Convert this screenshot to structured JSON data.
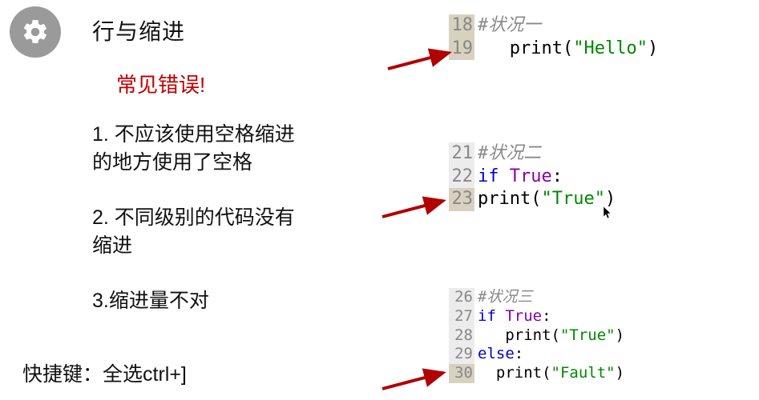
{
  "header": {
    "title": "行与缩进",
    "subtitle": "常见错误!"
  },
  "bullets": {
    "b1": "1. 不应该使用空格缩进\n    的地方使用了空格",
    "b2": "2. 不同级别的代码没有\n    缩进",
    "b3": "3.缩进量不对"
  },
  "shortcut": "快捷键：全选ctrl+]",
  "code1": {
    "l18_num": "18",
    "l18_comment": "#状况一",
    "l19_num": "19",
    "l19_indent": "   ",
    "l19_fn": "print",
    "l19_lp": "(",
    "l19_str": "\"Hello\"",
    "l19_rp": ")"
  },
  "code2": {
    "l21_num": "21",
    "l21_comment": "#状况二",
    "l22_num": "22",
    "l22_kw": "if",
    "l22_sp": " ",
    "l22_bool": "True",
    "l22_colon": ":",
    "l23_num": "23",
    "l23_fn": "print",
    "l23_lp": "(",
    "l23_str": "\"True\"",
    "l23_rp": ")"
  },
  "code3": {
    "l26_num": "26",
    "l26_comment": "#状况三",
    "l27_num": "27",
    "l27_kw": "if",
    "l27_sp": " ",
    "l27_bool": "True",
    "l27_colon": ":",
    "l28_num": "28",
    "l28_indent": "   ",
    "l28_fn": "print",
    "l28_lp": "(",
    "l28_str": "\"True\"",
    "l28_rp": ")",
    "l29_num": "29",
    "l29_kw": "else",
    "l29_colon": ":",
    "l30_num": "30",
    "l30_indent": "  ",
    "l30_fn": "print",
    "l30_lp": "(",
    "l30_str": "\"Fault\"",
    "l30_rp": ")"
  }
}
